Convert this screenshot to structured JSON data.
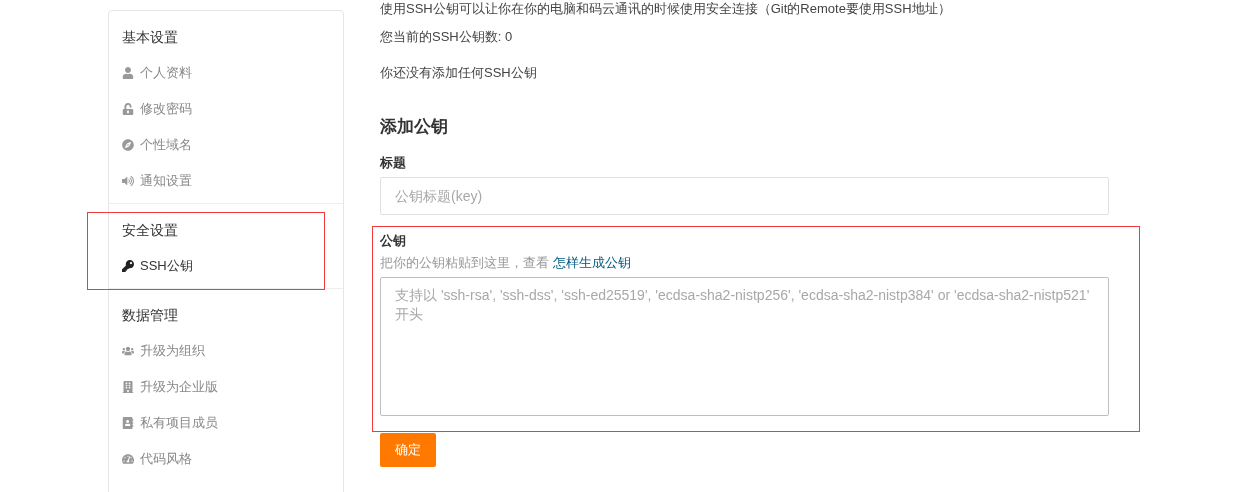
{
  "sidebar": {
    "sections": [
      {
        "title": "基本设置",
        "highlighted": false,
        "items": [
          {
            "label": "个人资料",
            "selected": false
          },
          {
            "label": "修改密码",
            "selected": false
          },
          {
            "label": "个性域名",
            "selected": false
          },
          {
            "label": "通知设置",
            "selected": false
          }
        ]
      },
      {
        "title": "安全设置",
        "highlighted": true,
        "items": [
          {
            "label": "SSH公钥",
            "selected": true
          }
        ]
      },
      {
        "title": "数据管理",
        "highlighted": false,
        "items": [
          {
            "label": "升级为组织",
            "selected": false
          },
          {
            "label": "升级为企业版",
            "selected": false
          },
          {
            "label": "私有项目成员",
            "selected": false
          },
          {
            "label": "代码风格",
            "selected": false
          }
        ]
      }
    ]
  },
  "main": {
    "intro": "使用SSH公钥可以让你在你的电脑和码云通讯的时候使用安全连接（Git的Remote要使用SSH地址）",
    "count": "您当前的SSH公钥数: 0",
    "empty": "你还没有添加任何SSH公钥",
    "form": {
      "heading": "添加公钥",
      "title_field": {
        "label": "标题",
        "placeholder": "公钥标题(key)"
      },
      "key_field": {
        "label": "公钥",
        "hint": "把你的公钥粘贴到这里，查看",
        "hint_link": "怎样生成公钥",
        "placeholder": "支持以 'ssh-rsa', 'ssh-dss', 'ssh-ed25519', 'ecdsa-sha2-nistp256', 'ecdsa-sha2-nistp384' or 'ecdsa-sha2-nistp521' 开头",
        "highlighted": true
      },
      "submit": "确定"
    }
  }
}
